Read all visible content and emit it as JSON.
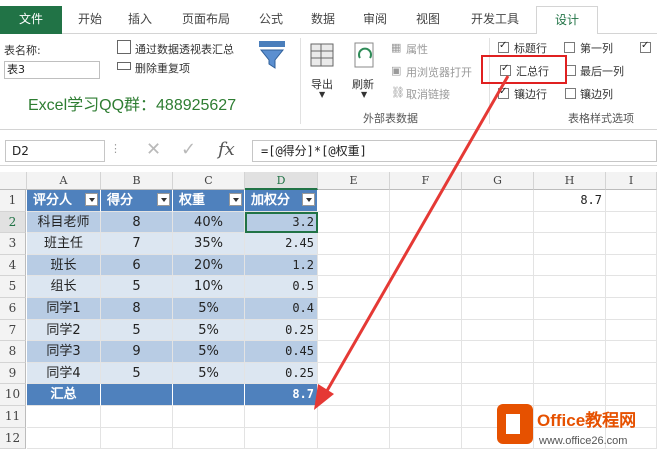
{
  "tabs": [
    "文件",
    "开始",
    "插入",
    "页面布局",
    "公式",
    "数据",
    "审阅",
    "视图",
    "开发工具",
    "设计"
  ],
  "ribbon": {
    "table_name_label": "表名称:",
    "table_name_value": "表3",
    "pivot_btn": "通过数据透视表汇总",
    "remove_dup_btn": "删除重复项",
    "qq_group": "Excel学习QQ群：488925627",
    "export_btn": "导出",
    "refresh_btn": "刷新",
    "properties_btn": "属性",
    "open_browser_btn": "用浏览器打开",
    "unlink_btn": "取消链接",
    "external_group": "外部表数据",
    "style_options_group": "表格样式选项",
    "options": [
      {
        "label": "标题行",
        "checked": true
      },
      {
        "label": "第一列",
        "checked": false
      },
      {
        "label": "汇总行",
        "checked": true
      },
      {
        "label": "最后一列",
        "checked": false
      },
      {
        "label": "镶边行",
        "checked": true
      },
      {
        "label": "镶边列",
        "checked": false
      }
    ]
  },
  "formula_bar": {
    "cell_ref": "D2",
    "cancel_icon": "✕",
    "confirm_icon": "✓",
    "fx_icon": "fx",
    "formula": "=[@得分]*[@权重]"
  },
  "sheet": {
    "columns": [
      "A",
      "B",
      "C",
      "D",
      "E",
      "F",
      "G",
      "H",
      "I"
    ],
    "rows": [
      "1",
      "2",
      "3",
      "4",
      "5",
      "6",
      "7",
      "8",
      "9",
      "10",
      "11",
      "12"
    ],
    "headers": [
      "评分人",
      "得分",
      "权重",
      "加权分"
    ],
    "data": [
      [
        "科目老师",
        "8",
        "40%",
        "3.2"
      ],
      [
        "班主任",
        "7",
        "35%",
        "2.45"
      ],
      [
        "班长",
        "6",
        "20%",
        "1.2"
      ],
      [
        "组长",
        "5",
        "10%",
        "0.5"
      ],
      [
        "同学1",
        "8",
        "5%",
        "0.4"
      ],
      [
        "同学2",
        "5",
        "5%",
        "0.25"
      ],
      [
        "同学3",
        "9",
        "5%",
        "0.45"
      ],
      [
        "同学4",
        "5",
        "5%",
        "0.25"
      ]
    ],
    "total_label": "汇总",
    "total_value": "8.7",
    "h1_value": "8.7"
  },
  "watermark": {
    "brand": "Office教程网",
    "url": "www.office26.com"
  },
  "colors": {
    "excel_green": "#217346",
    "table_header": "#4f81bd",
    "band_light": "#dce6f1",
    "band_dark": "#b8cce4",
    "highlight_red": "#e02020"
  }
}
